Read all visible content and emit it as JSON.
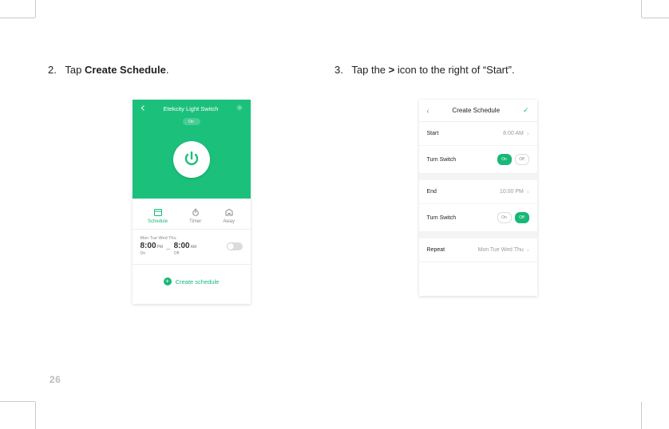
{
  "page_number": "26",
  "step2": {
    "number": "2.",
    "prefix": "Tap ",
    "bold": "Create Schedule",
    "suffix": "."
  },
  "step3": {
    "number": "3.",
    "prefix": "Tap the ",
    "bold": ">",
    "mid": " icon to the right of ",
    "quoted": "Start"
  },
  "phone1": {
    "title": "Etekcity Light Switch",
    "status": "On",
    "tabs": {
      "schedule": "Schedule",
      "timer": "Timer",
      "away": "Away"
    },
    "existing": {
      "days": "Mon Tue Wed Thu",
      "t1": "8:00",
      "t1_ampm": "PM",
      "t1_sub": "On",
      "t2": "8:00",
      "t2_ampm": "AM",
      "t2_sub": "Off"
    },
    "create_label": "Create schedule"
  },
  "phone2": {
    "title": "Create Schedule",
    "rows": {
      "start_label": "Start",
      "start_value": "8:00 AM",
      "ts1_label": "Turn Switch",
      "ts1_on": "On",
      "ts1_off": "Off",
      "end_label": "End",
      "end_value": "10:00 PM",
      "ts2_label": "Turn Switch",
      "ts2_on": "On",
      "ts2_off": "Off",
      "repeat_label": "Repeat",
      "repeat_value": "Mon Tue Wed Thu"
    }
  }
}
